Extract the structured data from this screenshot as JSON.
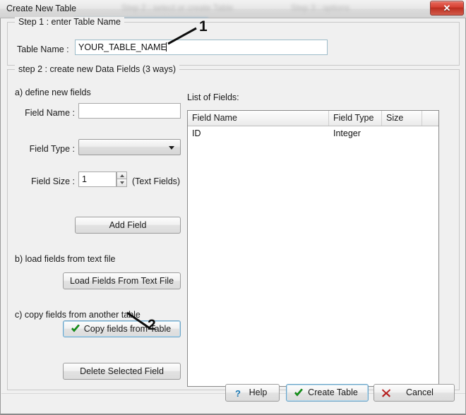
{
  "window": {
    "title": "Create New Table",
    "close_label": "✕",
    "ghost_text_1": "Step 2 : select or create Table",
    "ghost_text_2": "Step 3 : options"
  },
  "step1": {
    "legend": "Step 1 : enter Table Name",
    "table_name_label": "Table Name :",
    "table_name_value": "YOUR_TABLE_NAME"
  },
  "step2": {
    "legend": "step 2 : create new Data Fields (3 ways)",
    "section_a": "a) define new fields",
    "field_name_label": "Field Name :",
    "field_name_value": "",
    "field_type_label": "Field Type :",
    "field_type_value": "",
    "field_size_label": "Field Size :",
    "field_size_value": "1",
    "field_size_hint": "(Text Fields)",
    "add_field_label": "Add Field",
    "section_b": "b) load fields from text file",
    "load_fields_label": "Load Fields From Text File",
    "section_c": "c) copy fields from another table",
    "copy_fields_label": "Copy fields from Table",
    "delete_field_label": "Delete Selected Field"
  },
  "fields_list": {
    "caption": "List of Fields:",
    "columns": [
      "Field Name",
      "Field Type",
      "Size",
      ""
    ],
    "rows": [
      [
        "ID",
        "Integer",
        "",
        ""
      ]
    ]
  },
  "footer": {
    "help_label": "Help",
    "create_label": "Create Table",
    "cancel_label": "Cancel"
  },
  "annotations": {
    "one": "1",
    "two": "2"
  },
  "colors": {
    "accent_focus": "#6ba3c6",
    "check_green": "#13a019",
    "cancel_red": "#b41a1a",
    "help_blue": "#1878b4",
    "close_red": "#d74436"
  }
}
